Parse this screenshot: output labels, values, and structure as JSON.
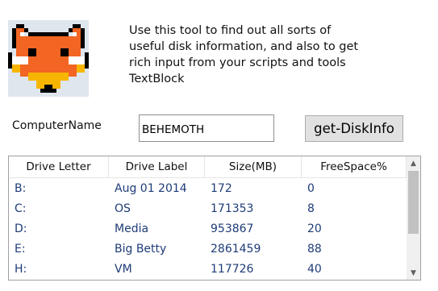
{
  "description": {
    "lines": [
      "Use this tool to find out all sorts of",
      "useful disk information, and also to get",
      "rich input from your scripts and tools",
      "TextBlock"
    ]
  },
  "form": {
    "computer_name_label": "ComputerName",
    "computer_name_value": "BEHEMOTH",
    "button_label": "get-DiskInfo"
  },
  "grid": {
    "columns": [
      "Drive Letter",
      "Drive Label",
      "Size(MB)",
      "FreeSpace%"
    ],
    "rows": [
      [
        "B:",
        "Aug 01 2014",
        "172",
        "0"
      ],
      [
        "C:",
        "OS",
        "171353",
        "8"
      ],
      [
        "D:",
        "Media",
        "953867",
        "20"
      ],
      [
        "E:",
        "Big Betty",
        "2861459",
        "88"
      ],
      [
        "H:",
        "VM",
        "117726",
        "40"
      ]
    ]
  },
  "icons": {
    "logo": "fox-logo-icon",
    "scroll_up": "scroll-up-arrow-icon",
    "scroll_down": "scroll-down-arrow-icon"
  },
  "colors": {
    "cell_text": "#1e3c78",
    "button_bg": "#e1e1e1",
    "fox_orange": "#f26522",
    "fox_yellow": "#f7b500"
  }
}
